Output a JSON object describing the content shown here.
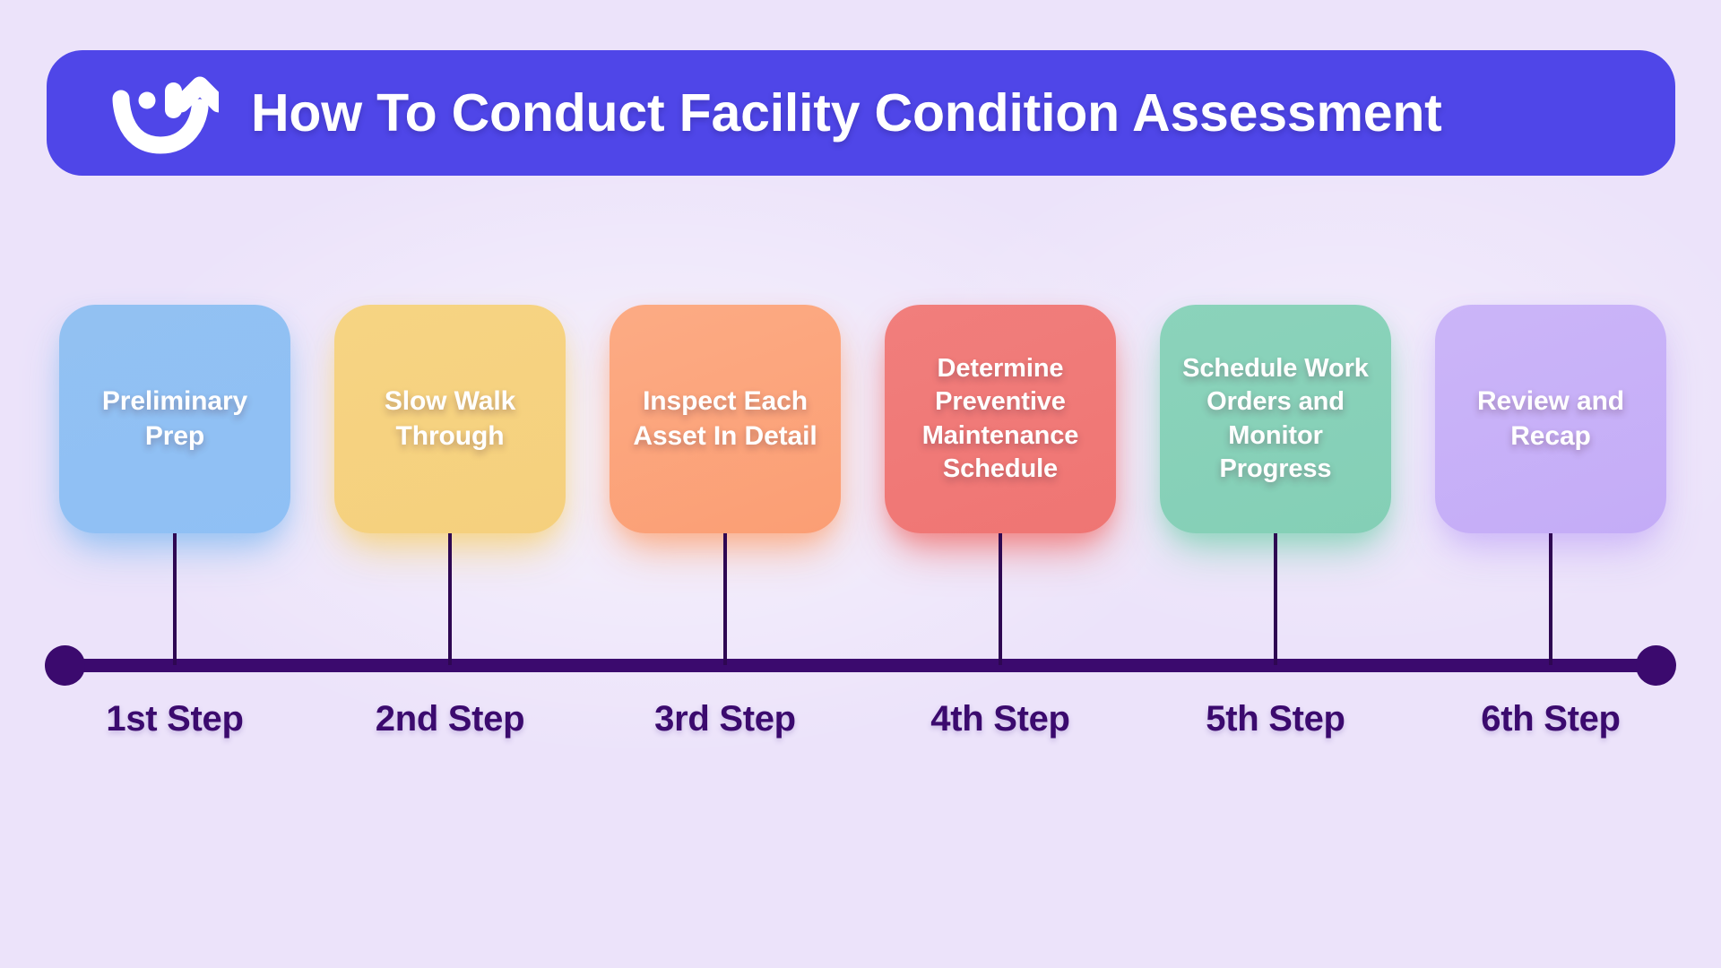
{
  "banner": {
    "title": "How To Conduct Facility Condition Assessment",
    "icon": "smiley-arrow-logo-icon",
    "background_color": "#4f46e8",
    "text_color": "#ffffff"
  },
  "page": {
    "background_color": "#ece3fa",
    "accent_color": "#3b0a6e"
  },
  "timeline": {
    "axis_color": "#3b0a6e",
    "connector_color": "#2e0752",
    "steps": [
      {
        "caption": "1st Step",
        "card_label": "Preliminary Prep",
        "card_color": "#92c1f2",
        "card_color_end": "#8fc0f5"
      },
      {
        "caption": "2nd Step",
        "card_label": "Slow Walk Through",
        "card_color": "#f6d483",
        "card_color_end": "#f5d07d"
      },
      {
        "caption": "3rd Step",
        "card_label": "Inspect Each Asset In Detail",
        "card_color": "#fcab84",
        "card_color_end": "#fb9e74"
      },
      {
        "caption": "4th Step",
        "card_label": "Determine Preventive Maintenance Schedule",
        "card_color": "#f17e7c",
        "card_color_end": "#ef7573"
      },
      {
        "caption": "5th Step",
        "card_label": "Schedule Work Orders and Monitor Progress",
        "card_color": "#8bd3bb",
        "card_color_end": "#84cfb6"
      },
      {
        "caption": "6th Step",
        "card_label": "Review and Recap",
        "card_color": "#cbb5f8",
        "card_color_end": "#c4acf7"
      }
    ]
  }
}
